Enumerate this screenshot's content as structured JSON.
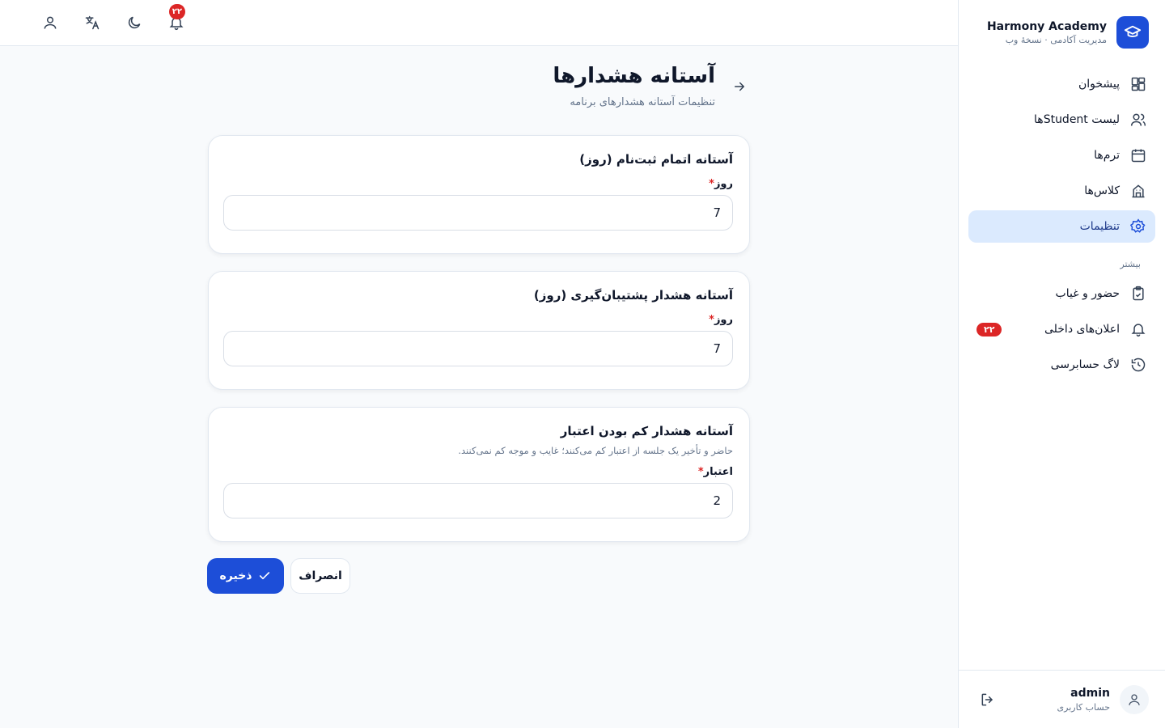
{
  "brand": {
    "name": "Harmony Academy",
    "subtitle": "مدیریت آکادمی · نسخهٔ وب"
  },
  "nav": {
    "items": [
      {
        "label": "پیشخوان",
        "icon": "dashboard-icon"
      },
      {
        "label": "لیست Studentها",
        "icon": "users-icon"
      },
      {
        "label": "ترم‌ها",
        "icon": "calendar-icon"
      },
      {
        "label": "کلاس‌ها",
        "icon": "building-icon"
      },
      {
        "label": "تنظیمات",
        "icon": "gear-icon",
        "active": true
      }
    ],
    "section_label": "بیشتر",
    "more_items": [
      {
        "label": "حضور و غیاب",
        "icon": "clipboard-icon"
      },
      {
        "label": "اعلان‌های داخلی",
        "icon": "bell-icon",
        "badge": "۲۲"
      },
      {
        "label": "لاگ حسابرسی",
        "icon": "history-icon"
      }
    ]
  },
  "user": {
    "name": "admin",
    "role": "حساب کاربری"
  },
  "topbar": {
    "notification_badge": "۲۲"
  },
  "page": {
    "title": "آستانه هشدارها",
    "subtitle": "تنظیمات آستانه هشدارهای برنامه"
  },
  "cards": [
    {
      "title": "آستانه اتمام ثبت‌نام (روز)",
      "field_label": "روز",
      "required_mark": "*",
      "value": "7"
    },
    {
      "title": "آستانه هشدار پشتیبان‌گیری (روز)",
      "field_label": "روز",
      "required_mark": "*",
      "value": "7"
    },
    {
      "title": "آستانه هشدار کم بودن اعتبار",
      "description": "حاضر و تأخیر یک جلسه از اعتبار کم می‌کنند؛ غایب و موجه کم نمی‌کنند.",
      "field_label": "اعتبار",
      "required_mark": "*",
      "value": "2"
    }
  ],
  "actions": {
    "save_label": "ذخیره",
    "cancel_label": "انصراف"
  },
  "colors": {
    "primary": "#1d4ed8",
    "active_bg": "#dbeafe",
    "badge": "#dc2626"
  }
}
